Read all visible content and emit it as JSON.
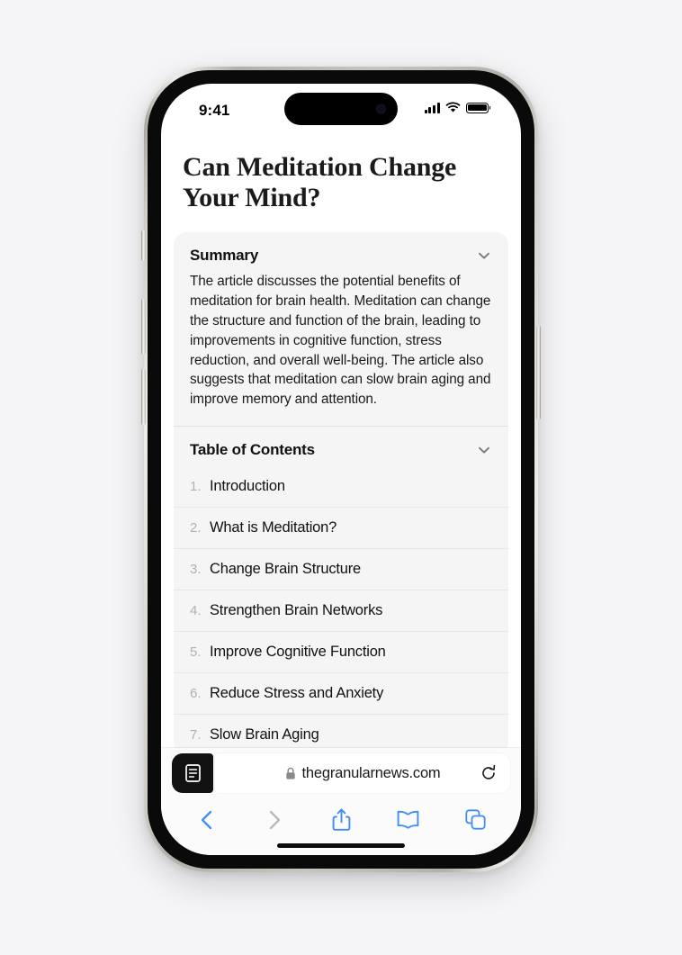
{
  "device": {
    "name": "iphone-15-pro",
    "status_bar": {
      "time": "9:41",
      "signal_icon": "cellular-signal-icon",
      "wifi_icon": "wifi-icon",
      "battery_icon": "battery-full-icon"
    },
    "buttons": {
      "action_button": "action-button",
      "volume_up": "volume-up-button",
      "volume_down": "volume-down-button",
      "power": "power-button"
    },
    "home_indicator": "home-indicator"
  },
  "article": {
    "title": "Can Meditation Change Your Mind?"
  },
  "reader": {
    "summary": {
      "heading": "Summary",
      "chevron_icon": "chevron-down-icon",
      "body": "The article discusses the potential benefits of meditation for brain health. Meditation can change the structure and function of the brain, leading to improvements in cognitive function, stress reduction, and overall well-being. The article also suggests that meditation can slow brain aging and improve memory and attention."
    },
    "table_of_contents": {
      "heading": "Table of Contents",
      "chevron_icon": "chevron-down-icon",
      "items": [
        {
          "number": "1.",
          "label": "Introduction"
        },
        {
          "number": "2.",
          "label": "What is Meditation?"
        },
        {
          "number": "3.",
          "label": "Change Brain Structure"
        },
        {
          "number": "4.",
          "label": "Strengthen Brain Networks"
        },
        {
          "number": "5.",
          "label": "Improve Cognitive Function"
        },
        {
          "number": "6.",
          "label": "Reduce Stress and Anxiety"
        },
        {
          "number": "7.",
          "label": "Slow Brain Aging"
        }
      ]
    }
  },
  "browser": {
    "reader_mode_icon": "reader-mode-icon",
    "lock_icon": "lock-icon",
    "url": "thegranularnews.com",
    "reload_icon": "reload-icon",
    "toolbar": {
      "back": {
        "icon": "chevron-left-icon",
        "label": "Back",
        "enabled": true
      },
      "forward": {
        "icon": "chevron-right-icon",
        "label": "Forward",
        "enabled": false
      },
      "share": {
        "icon": "share-icon",
        "label": "Share"
      },
      "bookmarks": {
        "icon": "book-icon",
        "label": "Bookmarks"
      },
      "tabs": {
        "icon": "tabs-icon",
        "label": "Tabs"
      }
    }
  },
  "colors": {
    "page_background": "#f5f5f7",
    "card_background": "#f5f5f5",
    "accent_blue": "#3f8df5",
    "disabled_gray": "#b9b9bd",
    "muted_number": "#b0b0b0"
  }
}
